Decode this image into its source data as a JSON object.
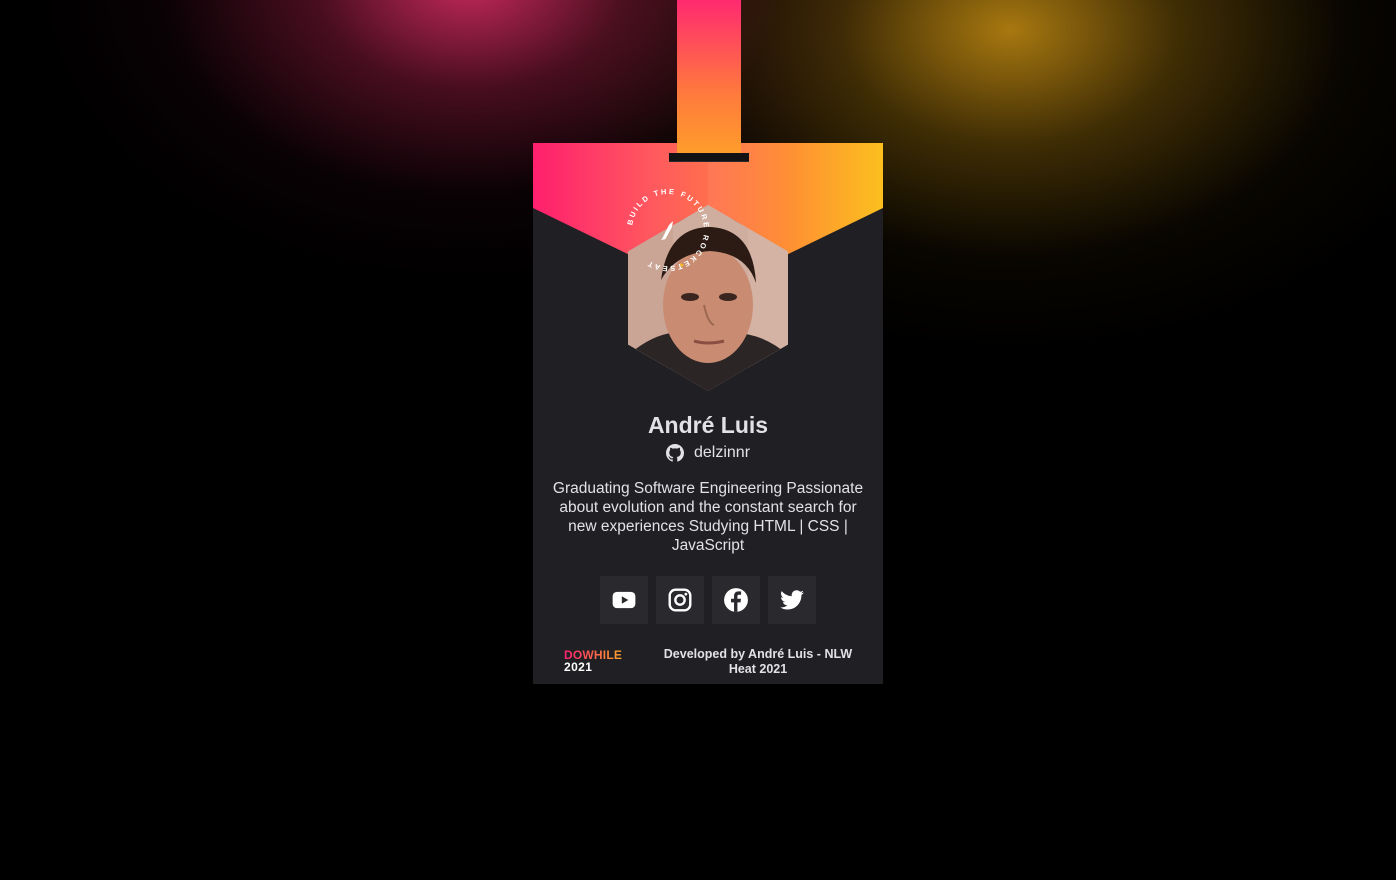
{
  "profile": {
    "name": "André Luis",
    "github_username": "delzinnr",
    "bio": "Graduating Software Engineering Passionate about evolution and the constant search for new experiences Studying HTML | CSS | JavaScript"
  },
  "seal": {
    "text_top": "BUILD THE FUTURE",
    "text_side": "ROCKETSEAT"
  },
  "socials": [
    {
      "name": "youtube",
      "icon": "youtube-icon"
    },
    {
      "name": "instagram",
      "icon": "instagram-icon"
    },
    {
      "name": "facebook",
      "icon": "facebook-icon"
    },
    {
      "name": "twitter",
      "icon": "twitter-icon"
    }
  ],
  "footer": {
    "event_logo_top": "DOWHILE",
    "event_logo_year": "2021",
    "credit": "Developed by André Luis - NLW Heat 2021"
  },
  "colors": {
    "background": "#000000",
    "badge": "#202024",
    "social_button": "#29292E",
    "text": "#E1E1E6",
    "gradient_start": "#FF1F6E",
    "gradient_end": "#FBBF1E"
  }
}
